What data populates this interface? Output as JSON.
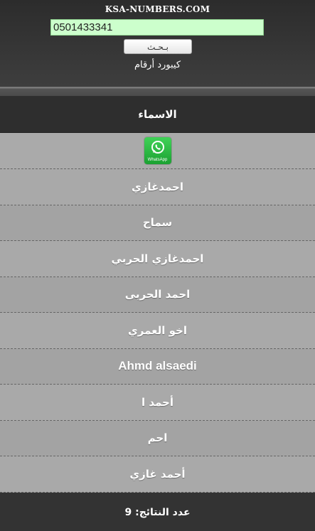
{
  "header": {
    "site_title": "KSA-NUMBERS.COM",
    "search_value": "0501433341",
    "search_button": "بـحـث",
    "keyboard_link": "كيبورد أرقام"
  },
  "results": {
    "column_header": "الاسماء",
    "whatsapp_label": "WhatsApp",
    "names": [
      "احمدغازي",
      "سماح",
      "احمدغازي الحربي",
      "احمد الحربى",
      "اخو العمري",
      "Ahmd alsaedi",
      "أحمد ا",
      "احم",
      "أحمد غازي"
    ]
  },
  "footer": {
    "results_count": "عدد النتائج: 9"
  },
  "colors": {
    "header_bg": "#333333",
    "row_bg": "#a9a9a9",
    "input_bg": "#ccffcc",
    "whatsapp_green": "#25d366"
  }
}
